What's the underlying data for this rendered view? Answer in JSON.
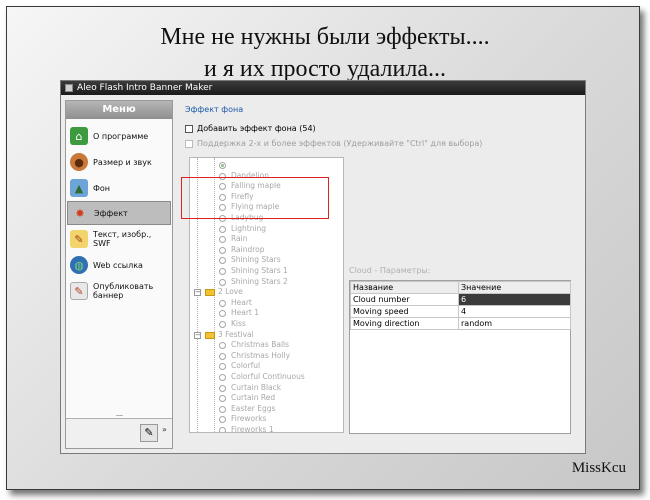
{
  "caption": {
    "line1": "Мне не нужны были эффекты....",
    "line2": "и я их просто удалила...",
    "signature": "MissKcu"
  },
  "window": {
    "title": "Aleo Flash Intro Banner Maker"
  },
  "sidebar": {
    "header": "Меню",
    "items": [
      {
        "label": "О программе",
        "icon": "home-icon"
      },
      {
        "label": "Размер и звук",
        "icon": "cookie-icon"
      },
      {
        "label": "Фон",
        "icon": "image-icon"
      },
      {
        "label": "Эффект",
        "icon": "sparkle-icon",
        "active": true
      },
      {
        "label": "Текст, изобр., SWF",
        "icon": "pencil-icon"
      },
      {
        "label": "Web ссылка",
        "icon": "globe-icon"
      },
      {
        "label": "Опубликовать баннер",
        "icon": "publish-icon"
      }
    ],
    "grip": "........",
    "footer_arrow": "»"
  },
  "main": {
    "section_title": "Эффект фона",
    "add_effect_checkbox": "Добавить эффект фона (54)",
    "support_checkbox": "Поддержка 2-х и более эффектов (Удерживайте \"Ctrl\" для выбора)",
    "tree": [
      {
        "label": "",
        "level": 2,
        "type": "radio",
        "selected": true
      },
      {
        "label": "Dandelion",
        "level": 2,
        "type": "radio"
      },
      {
        "label": "Falling maple",
        "level": 2,
        "type": "radio"
      },
      {
        "label": "Firefly",
        "level": 2,
        "type": "radio"
      },
      {
        "label": "Flying maple",
        "level": 2,
        "type": "radio"
      },
      {
        "label": "Ladybug",
        "level": 2,
        "type": "radio"
      },
      {
        "label": "Lightning",
        "level": 2,
        "type": "radio"
      },
      {
        "label": "Rain",
        "level": 2,
        "type": "radio"
      },
      {
        "label": "Raindrop",
        "level": 2,
        "type": "radio"
      },
      {
        "label": "Shining Stars",
        "level": 2,
        "type": "radio"
      },
      {
        "label": "Shining Stars 1",
        "level": 2,
        "type": "radio"
      },
      {
        "label": "Shining Stars 2",
        "level": 2,
        "type": "radio"
      },
      {
        "label": "2 Love",
        "level": 1,
        "type": "folder"
      },
      {
        "label": "Heart",
        "level": 2,
        "type": "radio"
      },
      {
        "label": "Heart 1",
        "level": 2,
        "type": "radio"
      },
      {
        "label": "Kiss",
        "level": 2,
        "type": "radio"
      },
      {
        "label": "3 Festival",
        "level": 1,
        "type": "folder"
      },
      {
        "label": "Christmas Balls",
        "level": 2,
        "type": "radio"
      },
      {
        "label": "Christmas Holly",
        "level": 2,
        "type": "radio"
      },
      {
        "label": "Colorful",
        "level": 2,
        "type": "radio"
      },
      {
        "label": "Colorful Continuous",
        "level": 2,
        "type": "radio"
      },
      {
        "label": "Curtain Black",
        "level": 2,
        "type": "radio"
      },
      {
        "label": "Curtain Red",
        "level": 2,
        "type": "radio"
      },
      {
        "label": "Easter Eggs",
        "level": 2,
        "type": "radio"
      },
      {
        "label": "Fireworks",
        "level": 2,
        "type": "radio"
      },
      {
        "label": "Fireworks 1",
        "level": 2,
        "type": "radio"
      }
    ],
    "params_label": "Cloud - Параметры:",
    "params": {
      "headers": [
        "Название",
        "Значение"
      ],
      "rows": [
        [
          "Cloud number",
          "6"
        ],
        [
          "Moving speed",
          "4"
        ],
        [
          "Moving direction",
          "random"
        ]
      ]
    }
  },
  "colors": {
    "accent_title": "#1c5aa6",
    "highlight_box": "#e02020",
    "selected_cell": "#3b3b3b"
  }
}
